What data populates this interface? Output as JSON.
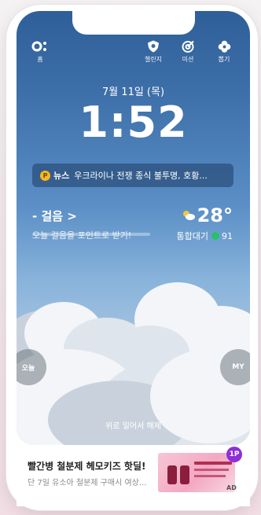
{
  "topbar": {
    "home": {
      "icon": "profile-toggle-icon",
      "label": "홈"
    },
    "challenge": {
      "icon": "shield-icon",
      "label": "챌린지"
    },
    "mission": {
      "icon": "target-icon",
      "label": "미션"
    },
    "lottery": {
      "icon": "clover-icon",
      "label": "뽑기"
    }
  },
  "lockscreen": {
    "date": "7월 11일 (목)",
    "time": "1:52",
    "unlock_hint": "위로 밀어서 해제"
  },
  "news": {
    "icon_label": "P",
    "tag": "뉴스",
    "headline": "우크라이나 전쟁 종식 불투명, 호황..."
  },
  "steps": {
    "title": "- 걸음 >",
    "subtitle": "오늘 걸음을 포인트로 받기!",
    "progress": 0
  },
  "weather": {
    "icon": "partly-cloudy-icon",
    "temperature": "28°",
    "air_label": "통합대기",
    "air_value": "91",
    "air_color": "#27c06b"
  },
  "side_buttons": {
    "left": "오늘",
    "right": "MY"
  },
  "ad": {
    "title": "빨간병 철분제 헤모키즈 핫딜!",
    "description": "단 7일 유소아 철분제 구매시 여상...",
    "badge": "1P",
    "mark": "AD"
  }
}
